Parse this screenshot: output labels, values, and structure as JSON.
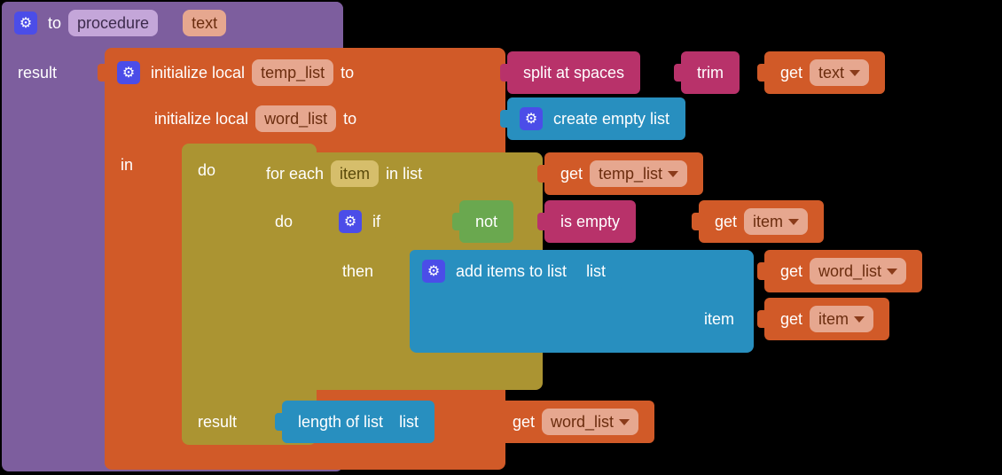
{
  "procedure": {
    "to_label": "to",
    "name": "procedure",
    "param": "text",
    "result_label": "result"
  },
  "locals": {
    "init_label_1": "initialize local",
    "var1": "temp_list",
    "to1": "to",
    "init_label_2": "initialize local",
    "var2": "word_list",
    "to2": "to",
    "in_label": "in"
  },
  "split": {
    "label": "split at spaces"
  },
  "trim": {
    "label": "trim"
  },
  "get_text": {
    "get": "get",
    "var": "text"
  },
  "create_empty": {
    "label": "create empty list"
  },
  "do_result": {
    "do": "do",
    "result": "result"
  },
  "foreach": {
    "label1": "for each",
    "item": "item",
    "label2": "in list",
    "do": "do",
    "then": "then"
  },
  "get_temp_list": {
    "get": "get",
    "var": "temp_list"
  },
  "if": {
    "label": "if"
  },
  "not": {
    "label": "not"
  },
  "is_empty": {
    "label": "is empty"
  },
  "get_item1": {
    "get": "get",
    "var": "item"
  },
  "add_items": {
    "label": "add items to list",
    "list": "list",
    "item": "item"
  },
  "get_word_list1": {
    "get": "get",
    "var": "word_list"
  },
  "get_item2": {
    "get": "get",
    "var": "item"
  },
  "length": {
    "label": "length of list",
    "list": "list"
  },
  "get_word_list2": {
    "get": "get",
    "var": "word_list"
  },
  "colors": {
    "purple": "#7d5e9e",
    "orange": "#d15a28",
    "magenta": "#b8326a",
    "blue": "#288fbf",
    "olive": "#ab9432",
    "green": "#6aa84f"
  }
}
